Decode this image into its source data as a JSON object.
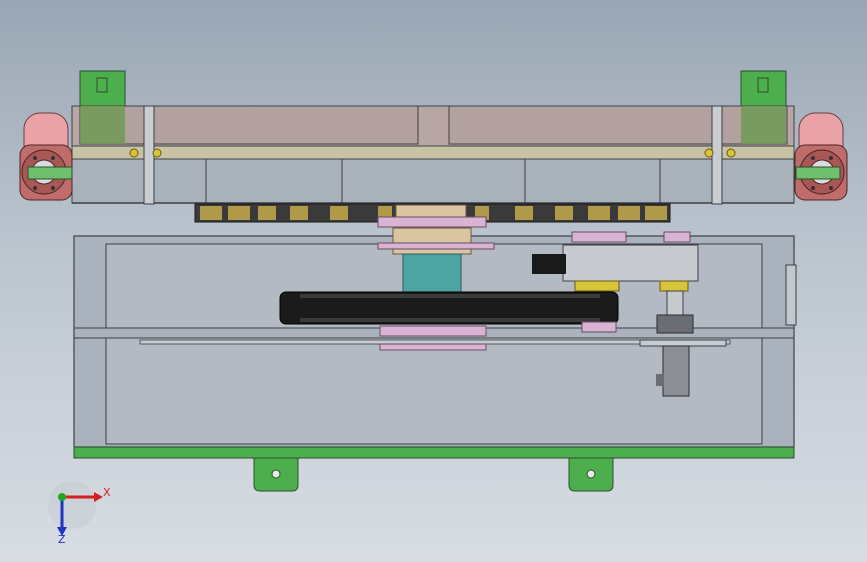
{
  "viewport": {
    "background_top": "#9aa6b4",
    "background_bottom": "#d8dde3"
  },
  "colors": {
    "frame_line": "#3c4046",
    "beam_fill": "#b8a6a4",
    "glass_fill": "#aab2bd",
    "green": "#4cae4c",
    "pink_roller": "#e9a3a6",
    "belt": "#1a1a1a",
    "pulley_tan": "#d9c6a0",
    "pulley_pink": "#d8b3d2",
    "shaft_teal": "#4fa5a3",
    "yellow_part": "#d8c43a"
  },
  "triad": {
    "x_label": "X",
    "z_label": "Z",
    "x_color": "#d42020",
    "y_color": "#1fa81f",
    "z_color": "#2030c8"
  },
  "icons": {
    "triad": "coordinate-triad-icon"
  }
}
